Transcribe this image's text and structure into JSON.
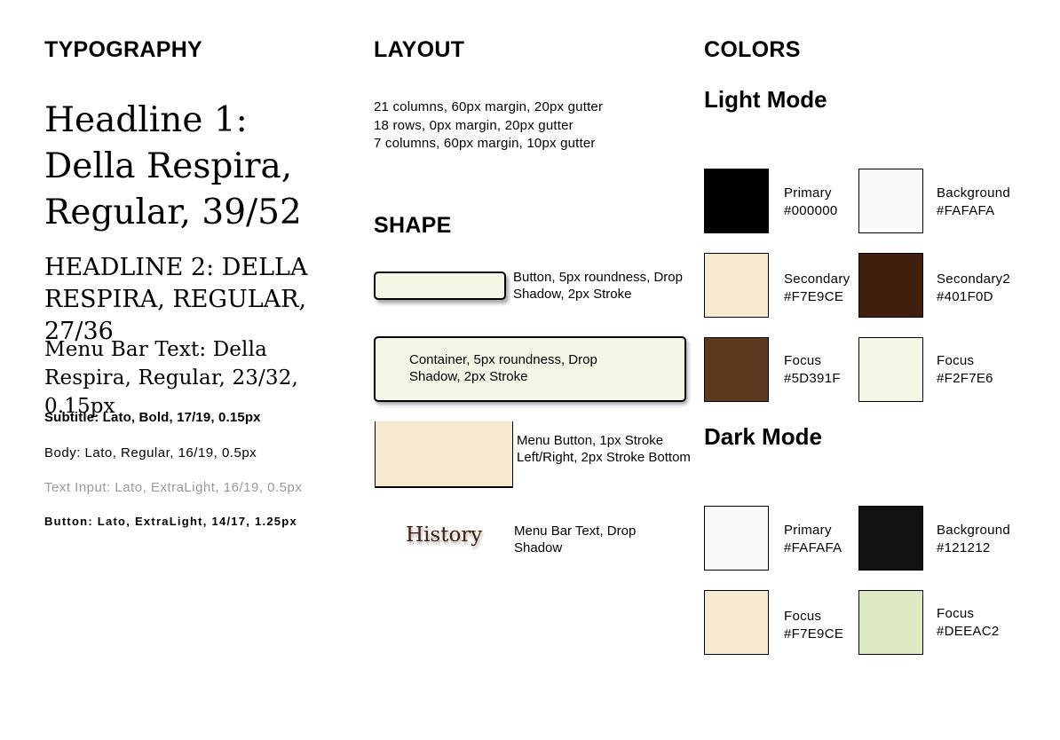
{
  "typography": {
    "title": "TYPOGRAPHY",
    "h1": "Headline 1: Della Respira, Regular, 39/52",
    "h2": "Headline 2: Della Respira, Regular, 27/36",
    "menubar": "Menu Bar Text: Della Respira, Regular, 23/32, 0.15px",
    "subtitle": "Subtitle: Lato, Bold, 17/19, 0.15px",
    "body": "Body: Lato, Regular, 16/19, 0.5px",
    "text_input": "Text Input: Lato, ExtraLight, 16/19, 0.5px",
    "button": "Button: Lato, ExtraLight, 14/17, 1.25px"
  },
  "layout": {
    "title": "LAYOUT",
    "lines": [
      "21 columns, 60px margin, 20px gutter",
      "18 rows, 0px margin, 20px gutter",
      "7 columns, 60px margin, 10px gutter"
    ]
  },
  "shape": {
    "title": "SHAPE",
    "button_label": "Button, 5px roundness, Drop Shadow, 2px Stroke",
    "container_label": "Container, 5px roundness, Drop Shadow, 2px Stroke",
    "menu_button_label": "Menu Button, 1px Stroke Left/Right, 2px Stroke Bottom",
    "menu_bar_sample": "History",
    "menu_bar_label": "Menu Bar Text, Drop Shadow"
  },
  "colors": {
    "title": "COLORS",
    "light_mode": {
      "title": "Light Mode",
      "swatches": [
        {
          "name": "Primary",
          "hex": "#000000"
        },
        {
          "name": "Background",
          "hex": "#FAFAFA"
        },
        {
          "name": "Secondary",
          "hex": "#F7E9CE"
        },
        {
          "name": "Secondary2",
          "hex": "#401F0D"
        },
        {
          "name": "Focus",
          "hex": "#5D391F"
        },
        {
          "name": "Focus",
          "hex": "#F2F7E6"
        }
      ]
    },
    "dark_mode": {
      "title": "Dark Mode",
      "swatches": [
        {
          "name": "Primary",
          "hex": "#FAFAFA"
        },
        {
          "name": "Background",
          "hex": "#121212"
        },
        {
          "name": "Focus",
          "hex": "#F7E9CE"
        },
        {
          "name": "Focus",
          "hex": "#DEEAC2"
        }
      ]
    }
  }
}
